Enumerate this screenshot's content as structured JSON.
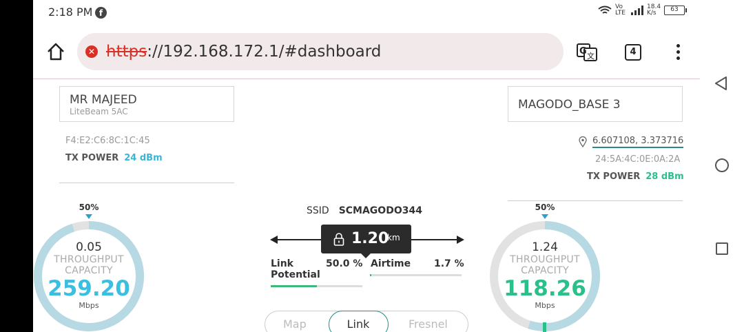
{
  "status_bar": {
    "time": "2:18 PM",
    "net_label": "Vo LTE",
    "speed": "18.4 K/s",
    "battery": "63"
  },
  "browser": {
    "url_scheme": "https",
    "url_rest": "://192.168.172.1/#dashboard",
    "tab_count": "4"
  },
  "left_device": {
    "name": "MR MAJEED",
    "model": "LiteBeam 5AC",
    "mac": "F4:E2:C6:8C:1C:45",
    "tx_label": "TX POWER",
    "tx_value": "24 dBm",
    "gauge": {
      "percent_label": "50%",
      "current": "0.05",
      "caption1": "THROUGHPUT",
      "caption2": "CAPACITY",
      "capacity": "259.20",
      "unit": "Mbps",
      "ring_fill": 0.95,
      "color": "#3bbfe0"
    }
  },
  "right_device": {
    "name": "MAGODO_BASE 3",
    "location": "6.607108, 3.373716",
    "mac": "24:5A:4C:0E:0A:2A",
    "tx_label": "TX POWER",
    "tx_value": "28 dBm",
    "gauge": {
      "percent_label": "50%",
      "current": "1.24",
      "caption1": "THROUGHPUT",
      "caption2": "CAPACITY",
      "capacity": "118.26",
      "unit": "Mbps",
      "ring_fill": 0.55,
      "color": "#2bbf8a"
    }
  },
  "link": {
    "ssid_label": "SSID",
    "ssid": "SCMAGODO344",
    "distance": "1.20",
    "distance_unit": "km",
    "link_potential_label_1": "Link",
    "link_potential_label_2": "Potential",
    "link_potential": "50.0 %",
    "link_potential_fraction": 0.5,
    "airtime_label": "Airtime",
    "airtime": "1.7 %",
    "airtime_fraction": 0.017
  },
  "tabs": {
    "map": "Map",
    "link": "Link",
    "fresnel": "Fresnel"
  },
  "colors": {
    "accent_teal": "#2a8a86",
    "left_accent": "#3bbfe0",
    "right_accent": "#2bbf8a",
    "bar_green": "#3cb878"
  }
}
